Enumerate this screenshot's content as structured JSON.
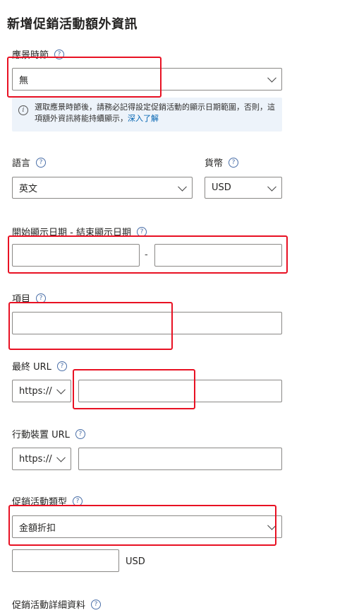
{
  "page_title": "新增促銷活動額外資訊",
  "season": {
    "label": "應景時節",
    "selected": "無"
  },
  "info_banner": {
    "text": "選取應景時節後，請務必記得設定促銷活動的顯示日期範圍，否則，這項額外資訊將能持續顯示，",
    "link_text": "深入了解"
  },
  "language": {
    "label": "語言",
    "selected": "英文"
  },
  "currency": {
    "label": "貨幣",
    "selected": "USD"
  },
  "display_dates": {
    "label": "開始顯示日期 - 結束顯示日期",
    "separator": "-",
    "start_value": "",
    "end_value": ""
  },
  "item": {
    "label": "項目",
    "value": ""
  },
  "final_url": {
    "label": "最終 URL",
    "protocol": "https://",
    "value": ""
  },
  "mobile_url": {
    "label": "行動裝置 URL",
    "protocol": "https://",
    "value": ""
  },
  "promotion_type": {
    "label": "促銷活動類型",
    "selected": "金額折扣",
    "amount_value": "",
    "unit": "USD"
  },
  "promotion_details": {
    "label": "促銷活動詳細資料"
  },
  "help_glyph": "?",
  "info_glyph": "i",
  "colors": {
    "highlight": "#e81123",
    "link": "#0063b1",
    "info_bg": "#edf3fa"
  }
}
